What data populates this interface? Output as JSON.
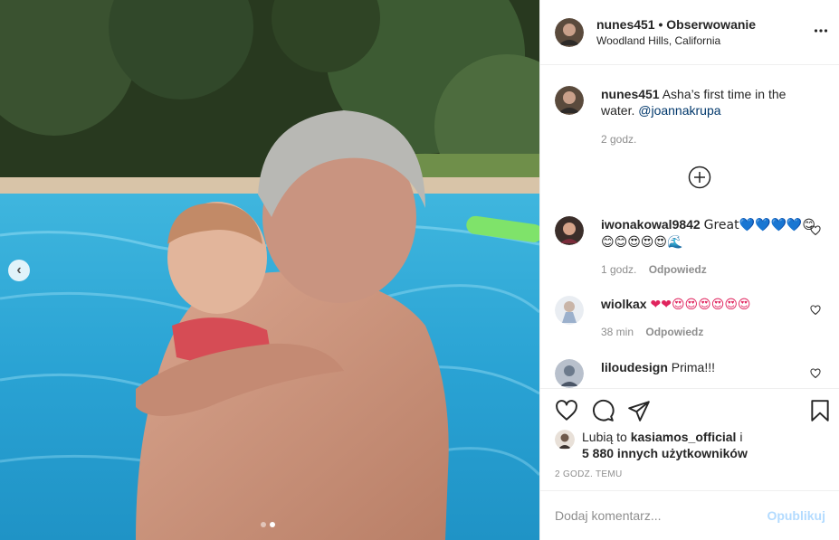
{
  "post": {
    "author": "nunes451",
    "follow_separator": " • ",
    "follow_label": "Obserwowanie",
    "location": "Woodland Hills, California",
    "caption": {
      "username": "nunes451",
      "text_1": "Asha’s first time in the water.",
      "mention": "@joannakrupa",
      "time": "2 godz."
    }
  },
  "comments": [
    {
      "username": "iwonakowal9842",
      "text": "Great💙💙💙💙😊😊😊😍😍😍🌊",
      "time": "1 godz.",
      "reply_label": "Odpowiedz"
    },
    {
      "username": "wiolkax",
      "text": "❤❤😍😍😍😍😍😍",
      "time": "38 min",
      "reply_label": "Odpowiedz"
    },
    {
      "username": "liloudesign",
      "text": "Prima!!!"
    }
  ],
  "likes": {
    "prefix": "Lubią to ",
    "user": "kasiamos_official",
    "conj": " i",
    "others": "5 880 innych użytkowników"
  },
  "timestamp": "2 godz. temu",
  "add_comment": {
    "placeholder": "Dodaj komentarz...",
    "submit_label": "Opublikuj"
  },
  "carousel": {
    "count": 2,
    "active": 2
  },
  "colors": {
    "pool": "#2aa8d6",
    "mention": "#00376b",
    "secondary_text": "#8e8e8e",
    "publish_disabled": "#b3dbff",
    "divider": "#efefef"
  }
}
